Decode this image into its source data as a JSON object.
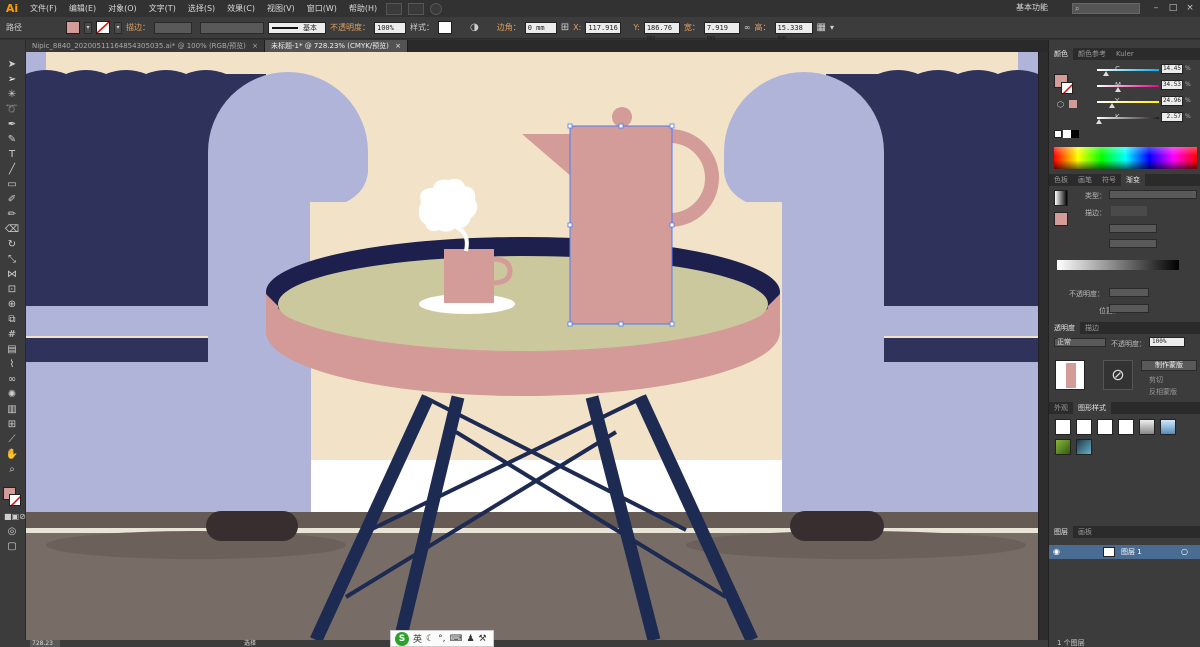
{
  "app": {
    "logo": "Ai",
    "workspace": "基本功能",
    "search_placeholder": ""
  },
  "menu": [
    "文件(F)",
    "编辑(E)",
    "对象(O)",
    "文字(T)",
    "选择(S)",
    "效果(C)",
    "视图(V)",
    "窗口(W)",
    "帮助(H)"
  ],
  "control_bar": {
    "selection_label": "路径",
    "stroke_label": "描边：",
    "stroke_style": "基本",
    "opacity_label": "不透明度：",
    "opacity_value": "100%",
    "style_label": "样式：",
    "corner_label": "边角：",
    "corner_value": "0 mm",
    "x_label": "X:",
    "x_value": "117.916",
    "y_label": "Y:",
    "y_value": "186.76 mm",
    "w_label": "宽：",
    "w_value": "7.919 mm",
    "h_label": "高：",
    "h_value": "15.338 mm"
  },
  "tabs": [
    {
      "label": "Nipic_8840_20200511164854305035.ai* @ 100% (RGB/预览)",
      "close": "×"
    },
    {
      "label": "未标题-1* @ 728.23% (CMYK/预览)",
      "close": "×"
    }
  ],
  "status": {
    "zoom": "728.23",
    "state": "选择"
  },
  "ime": {
    "logo": "S",
    "label": "英"
  },
  "color_panel": {
    "tabs": [
      "颜色",
      "颜色参考",
      "Kuler"
    ],
    "channels": [
      {
        "name": "C",
        "value": "14.45",
        "color": "#00aeef"
      },
      {
        "name": "M",
        "value": "34.53",
        "color": "#ec008c"
      },
      {
        "name": "Y",
        "value": "24.96",
        "color": "#fff200"
      },
      {
        "name": "K",
        "value": "2.57",
        "color": "#231f20"
      }
    ],
    "unit": "%",
    "fill_color": "#d49c98"
  },
  "gradient_panel": {
    "tabs": [
      "色板",
      "画笔",
      "符号",
      "渐变"
    ],
    "type_label": "类型：",
    "stroke_label": "描边：",
    "opacity_label": "不透明度：",
    "position_label": "位置："
  },
  "transparency_panel": {
    "tabs": [
      "透明度",
      "描边"
    ],
    "mode": "正常",
    "opacity_label": "不透明度：",
    "opacity_value": "100%",
    "make_mask": "制作蒙版",
    "clip": "剪切",
    "invert": "反相蒙版"
  },
  "graphic_styles_panel": {
    "tabs": [
      "外观",
      "图形样式"
    ]
  },
  "layers_panel": {
    "tabs": [
      "图层",
      "画板"
    ],
    "layer_name": "图层 1",
    "footer": "1 个图层"
  },
  "colors": {
    "wall": "#f2e3c8",
    "sofa_dark": "#2f335c",
    "sofa_light": "#b1b4d9",
    "table_top_dark": "#1d1f4d",
    "table_surface": "#cbc89e",
    "table_rim": "#d39a97",
    "legs": "#1d2a52",
    "floor": "#786d66",
    "pot": "#d49c98",
    "sofa_feet": "#382d2f",
    "selection": "#4a7bff"
  }
}
